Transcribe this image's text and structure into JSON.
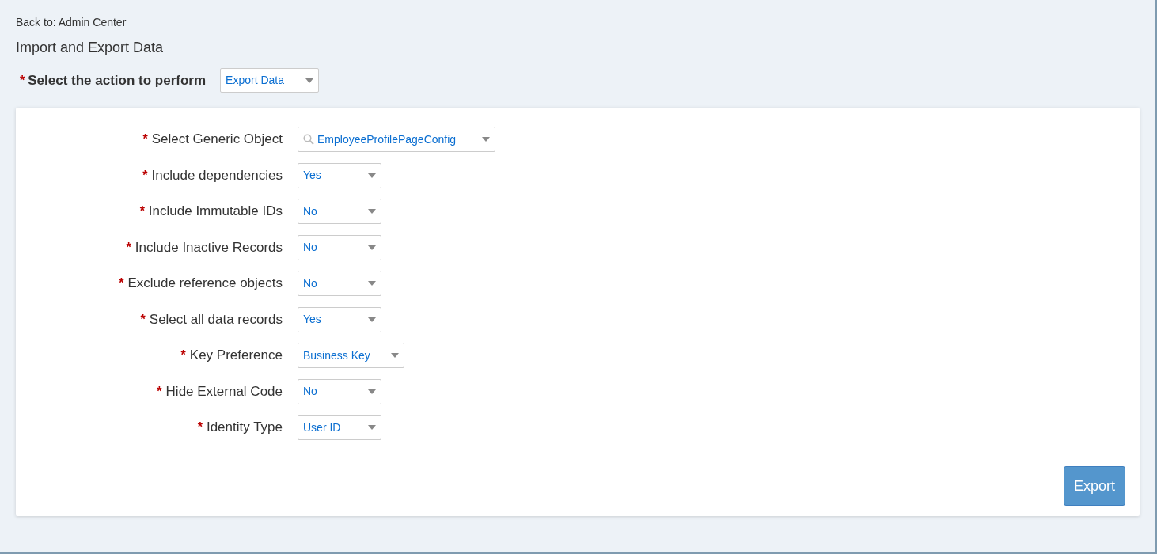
{
  "back_link": "Back to: Admin Center",
  "title": "Import and Export Data",
  "action": {
    "required_mark": "*",
    "label": "Select the action to perform",
    "value": "Export Data"
  },
  "fields": [
    {
      "kind": "search",
      "required_mark": "*",
      "label": "Select Generic Object",
      "value": "EmployeeProfilePageConfig"
    },
    {
      "kind": "select",
      "required_mark": "*",
      "label": "Include dependencies",
      "value": "Yes"
    },
    {
      "kind": "select",
      "required_mark": "*",
      "label": "Include Immutable IDs",
      "value": "No"
    },
    {
      "kind": "select",
      "required_mark": "*",
      "label": "Include Inactive Records",
      "value": "No"
    },
    {
      "kind": "select",
      "required_mark": "*",
      "label": "Exclude reference objects",
      "value": "No"
    },
    {
      "kind": "select",
      "required_mark": "*",
      "label": "Select all data records",
      "value": "Yes"
    },
    {
      "kind": "select",
      "required_mark": "*",
      "label": "Key Preference",
      "value": "Business Key"
    },
    {
      "kind": "select",
      "required_mark": "*",
      "label": "Hide External Code",
      "value": "No"
    },
    {
      "kind": "select",
      "required_mark": "*",
      "label": "Identity Type",
      "value": "User ID"
    }
  ],
  "submit_button": "Export"
}
